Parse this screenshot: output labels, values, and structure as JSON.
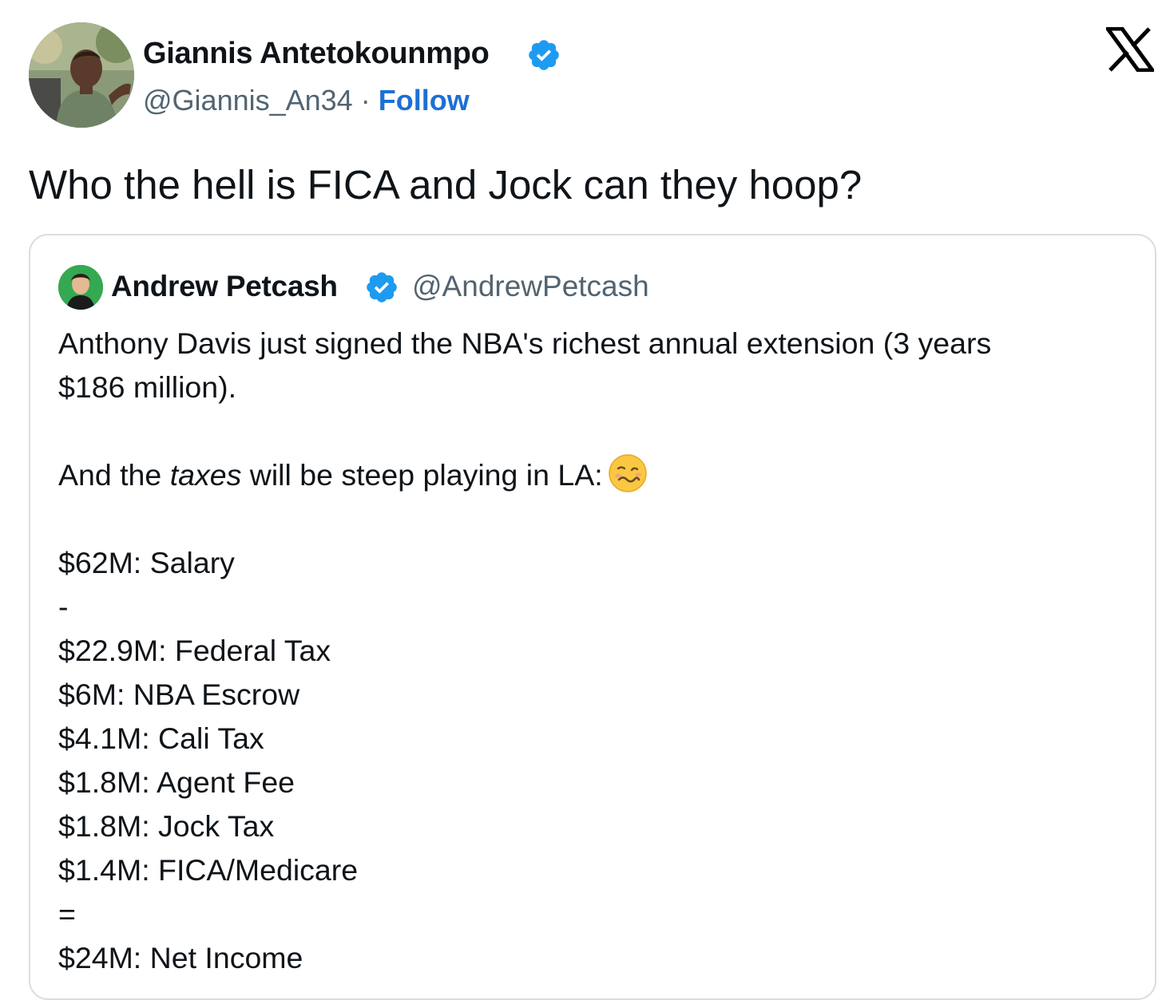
{
  "author": {
    "name": "Giannis Antetokounmpo",
    "handle": "@Giannis_An34",
    "separator": "·",
    "follow_label": "Follow",
    "avatar_icon": "profile-photo",
    "verified": true
  },
  "tweet_text": "Who the hell is FICA and Jock can they hoop?",
  "quoted": {
    "name": "Andrew Petcash",
    "handle": "@AndrewPetcash",
    "avatar_icon": "profile-photo",
    "verified": true,
    "intro_line1": "Anthony Davis just signed the NBA's richest annual extension (3 years",
    "intro_line2": "$186 million).",
    "taxes_prefix": "And the ",
    "taxes_word": "taxes",
    "taxes_suffix": " will be steep playing in LA:",
    "emoji_icon": "woozy-face-emoji",
    "salary_line": "$62M: Salary",
    "minus": "-",
    "deductions": [
      "$22.9M: Federal Tax",
      "$6M: NBA Escrow",
      "$4.1M: Cali Tax",
      "$1.8M: Agent Fee",
      "$1.8M: Jock Tax",
      "$1.4M: FICA/Medicare"
    ],
    "equals": "=",
    "net_line": "$24M: Net Income"
  },
  "colors": {
    "text": "#0f1419",
    "secondary": "#536471",
    "follow": "#1d6fd4",
    "verified": "#1d9bf0",
    "border": "#d9dee2"
  },
  "brand_icon": "x-logo-icon"
}
